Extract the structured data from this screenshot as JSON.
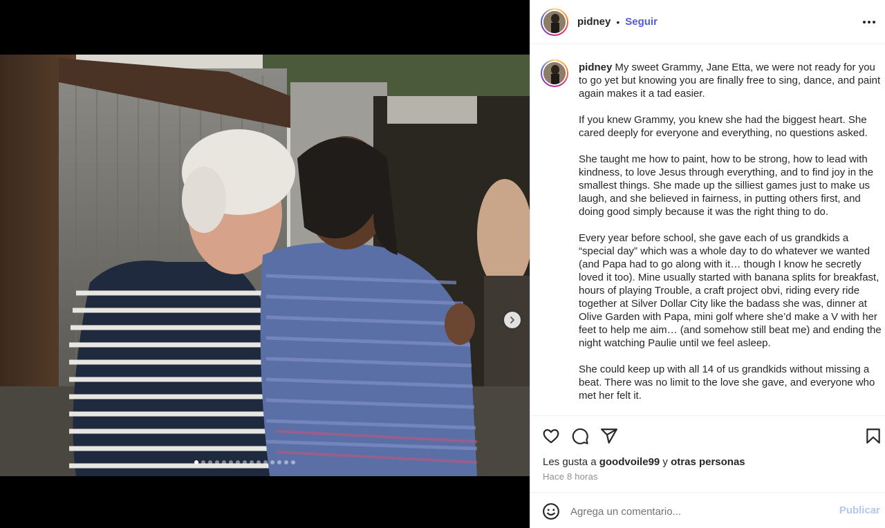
{
  "post": {
    "username": "pidney",
    "separator": "•",
    "follow_label": "Seguir",
    "more_icon": "more-horizontal-icon",
    "photo_dots_total": 15,
    "photo_dots_active": 1
  },
  "caption": {
    "username": "pidney",
    "paragraphs": [
      "My sweet Grammy, Jane Etta, we were not ready for you to go yet but knowing you are finally free to sing, dance, and paint again makes it a tad easier.",
      "If you knew Grammy, you knew she had the biggest heart. She cared deeply for everyone and everything, no questions asked.",
      "She taught me how to paint, how to be strong, how to lead with kindness, to love Jesus through everything, and to find joy in the smallest things. She made up the silliest games just to make us laugh, and she believed in fairness, in putting others first, and doing good simply because it was the right thing to do.",
      "Every year before school, she gave each of us grandkids a “special day” which was a whole day to do whatever we wanted (and Papa had to go along with it… though I know he secretly loved it too). Mine usually started with banana splits for breakfast, hours of playing Trouble, a craft project obvi, riding every ride together at Silver Dollar City like the badass she was, dinner at Olive Garden with Papa, mini golf where she’d make a V with her feet to help me aim… (and somehow still beat me) and ending the night watching Paulie until we feel asleep.",
      "She could keep up with all 14 of us grandkids without missing a beat. There was no limit to the love she gave, and everyone who met her felt it."
    ]
  },
  "actions": {
    "icons": [
      "heart-icon",
      "comment-icon",
      "share-icon",
      "bookmark-icon"
    ]
  },
  "likes": {
    "prefix": "Les gusta a ",
    "user": "goodvoile99",
    "middle": " y ",
    "others": "otras personas"
  },
  "time_ago": "Hace 8 horas",
  "comment": {
    "placeholder": "Agrega un comentario...",
    "publish_label": "Publicar"
  },
  "colors": {
    "follow": "#4f5bd5",
    "publish_disabled": "#b2c8f0",
    "muted": "#8e8e8e"
  }
}
